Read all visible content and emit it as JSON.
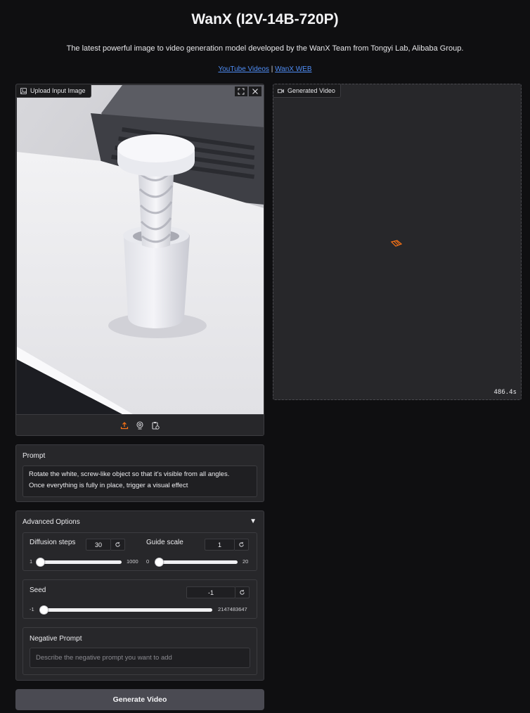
{
  "header": {
    "title": "WanX (I2V-14B-720P)",
    "subtitle": "The latest powerful image to video generation model developed by the WanX Team from Tongyi Lab, Alibaba Group.",
    "link_youtube": "YouTube Videos",
    "link_separator": "|",
    "link_web": "WanX WEB"
  },
  "upload": {
    "label": "Upload Input Image",
    "icons": [
      "fullscreen-icon",
      "close-icon",
      "upload-icon",
      "webcam-icon",
      "clipboard-icon"
    ]
  },
  "video": {
    "label": "Generated Video",
    "elapsed": "486.4s"
  },
  "prompt": {
    "label": "Prompt",
    "line1": "Rotate the white, screw-like object so that it's visible from all angles.",
    "line2": "Once everything is fully in place, trigger a visual effect"
  },
  "advanced": {
    "label": "Advanced Options",
    "arrow": "▼",
    "diffusion": {
      "label": "Diffusion steps",
      "value": "30",
      "min": "1",
      "max": "1000",
      "level": 0.029
    },
    "guide": {
      "label": "Guide scale",
      "value": "1",
      "min": "0",
      "max": "20",
      "level": 0.05
    },
    "seed": {
      "label": "Seed",
      "value": "-1",
      "min": "-1",
      "max": "2147483647",
      "level": 0.0
    },
    "negative": {
      "label": "Negative Prompt",
      "placeholder": "Describe the negative prompt you want to add"
    }
  },
  "generate": {
    "label": "Generate Video"
  },
  "colors": {
    "accent": "#f97316",
    "link": "#4f8df5",
    "panel": "#27272a",
    "background": "#0f0f11"
  }
}
